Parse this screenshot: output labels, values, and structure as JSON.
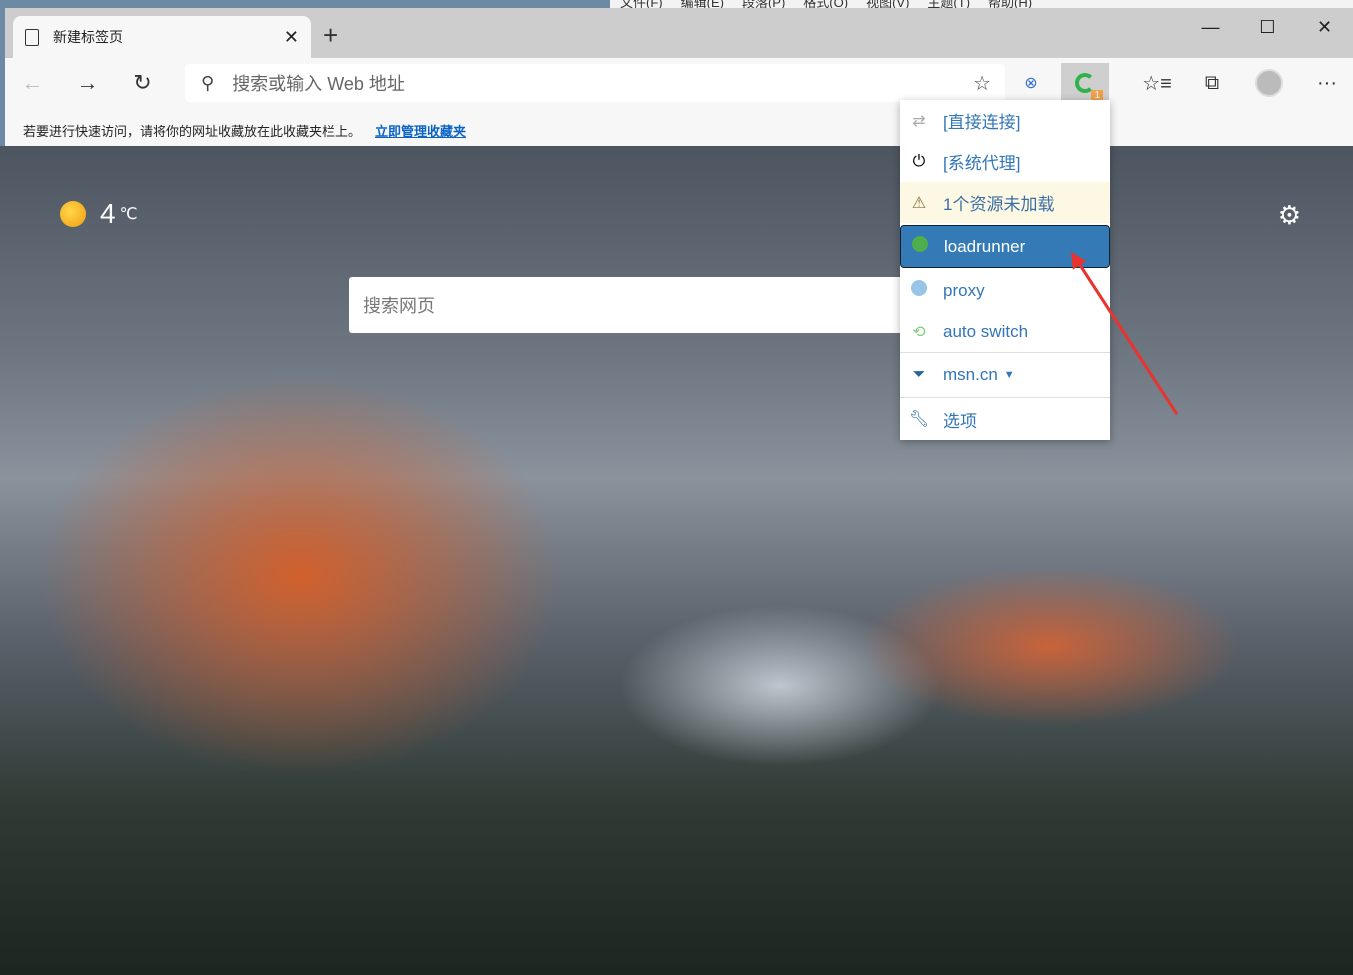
{
  "background_window": {
    "menu": [
      "文件(F)",
      "编辑(E)",
      "段落(P)",
      "格式(O)",
      "视图(V)",
      "主题(T)",
      "帮助(H)"
    ]
  },
  "tab": {
    "title": "新建标签页",
    "icon": "document-icon"
  },
  "address_bar": {
    "placeholder": "搜索或输入 Web 地址"
  },
  "extension_badge": "1",
  "favorites_bar": {
    "message": "若要进行快速访问，请将你的网址收藏放在此收藏夹栏上。",
    "link": "立即管理收藏夹"
  },
  "weather": {
    "temp": "4",
    "unit": "℃",
    "icon": "sun-icon"
  },
  "page_search": {
    "placeholder": "搜索网页"
  },
  "proxy_menu": {
    "items": [
      {
        "label": "[直接连接]",
        "icon": "transfer-icon"
      },
      {
        "label": "[系统代理]",
        "icon": "power-icon"
      },
      {
        "label": "1个资源未加载",
        "icon": "warning-icon"
      },
      {
        "label": "loadrunner",
        "icon": "globe-icon",
        "active": true
      },
      {
        "label": "proxy",
        "icon": "globe-icon"
      },
      {
        "label": "auto switch",
        "icon": "retweet-icon"
      },
      {
        "label": "msn.cn",
        "icon": "filter-icon"
      },
      {
        "label": "选项",
        "icon": "wrench-icon"
      }
    ]
  },
  "colors": {
    "accent": "#337ab7",
    "menu_text": "#3276b8",
    "warning_bg": "#fcf8e3",
    "annotation_arrow": "#e8332e"
  }
}
